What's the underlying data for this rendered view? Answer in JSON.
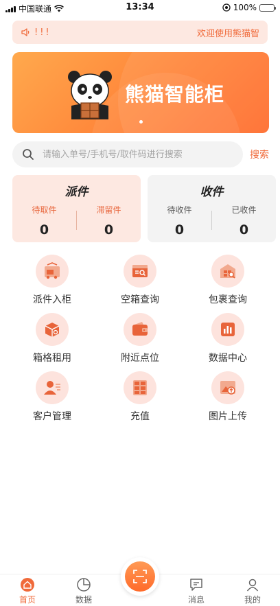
{
  "status_bar": {
    "carrier": "中国联通",
    "time": "13:34",
    "battery": "100%"
  },
  "notice": {
    "mark": "!!!",
    "text": "欢迎使用熊猫智"
  },
  "banner": {
    "title": "熊猫智能柜",
    "slides": 3,
    "active_slide": 1
  },
  "search": {
    "placeholder": "请输入单号/手机号/取件码进行搜索",
    "button_label": "搜索"
  },
  "dispatch_card": {
    "title": "派件",
    "left_label": "待取件",
    "left_value": "0",
    "right_label": "滞留件",
    "right_value": "0"
  },
  "receive_card": {
    "title": "收件",
    "left_label": "待收件",
    "left_value": "0",
    "right_label": "已收件",
    "right_value": "0"
  },
  "grid": [
    {
      "label": "派件入柜",
      "icon": "truck-cabinet-icon"
    },
    {
      "label": "空箱查询",
      "icon": "box-search-icon"
    },
    {
      "label": "包裹查询",
      "icon": "package-search-icon"
    },
    {
      "label": "箱格租用",
      "icon": "box-rent-icon"
    },
    {
      "label": "附近点位",
      "icon": "wallet-location-icon"
    },
    {
      "label": "数据中心",
      "icon": "bar-chart-icon"
    },
    {
      "label": "客户管理",
      "icon": "customer-icon"
    },
    {
      "label": "充值",
      "icon": "recharge-grid-icon"
    },
    {
      "label": "图片上传",
      "icon": "image-upload-icon"
    }
  ],
  "tab_bar": {
    "home": "首页",
    "data": "数据",
    "messages": "消息",
    "mine": "我的",
    "active": "home"
  },
  "colors": {
    "accent": "#f06a3a",
    "light_accent": "#fde8e1",
    "icon_bg": "#fde3dd"
  }
}
